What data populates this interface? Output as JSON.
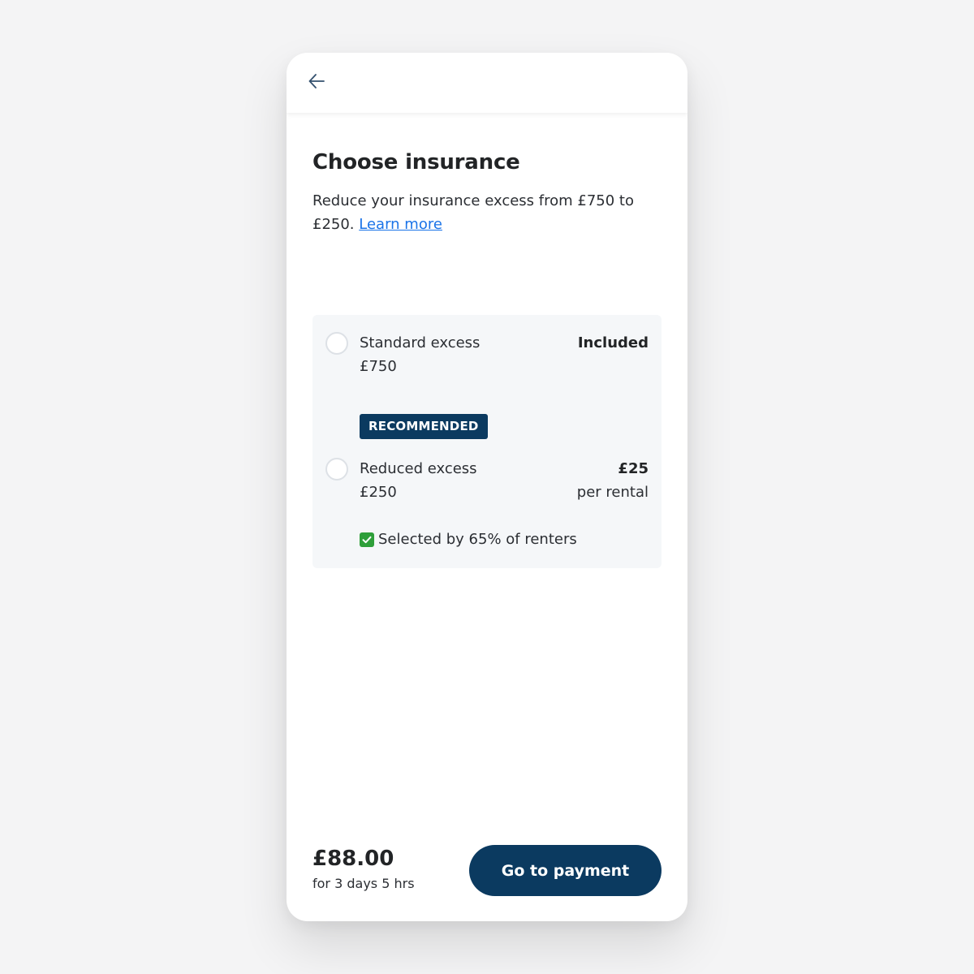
{
  "header": {
    "back_icon": "arrow-left-icon"
  },
  "page": {
    "title": "Choose insurance",
    "subtitle": "Reduce your insurance excess from £750 to £250.",
    "learn_more": "Learn more"
  },
  "options": [
    {
      "label": "Standard excess",
      "amount": "£750",
      "price": "Included",
      "selected": false
    },
    {
      "badge": "RECOMMENDED",
      "label": "Reduced excess",
      "amount": "£250",
      "price": "£25",
      "price_sub": "per rental",
      "social_proof": "Selected by 65% of renters",
      "selected": false
    }
  ],
  "footer": {
    "total": "£88.00",
    "duration": "for 3 days 5 hrs",
    "cta": "Go to payment"
  },
  "colors": {
    "brand": "#0b3a60",
    "link": "#1a73e8",
    "check": "#2e9f3a"
  }
}
